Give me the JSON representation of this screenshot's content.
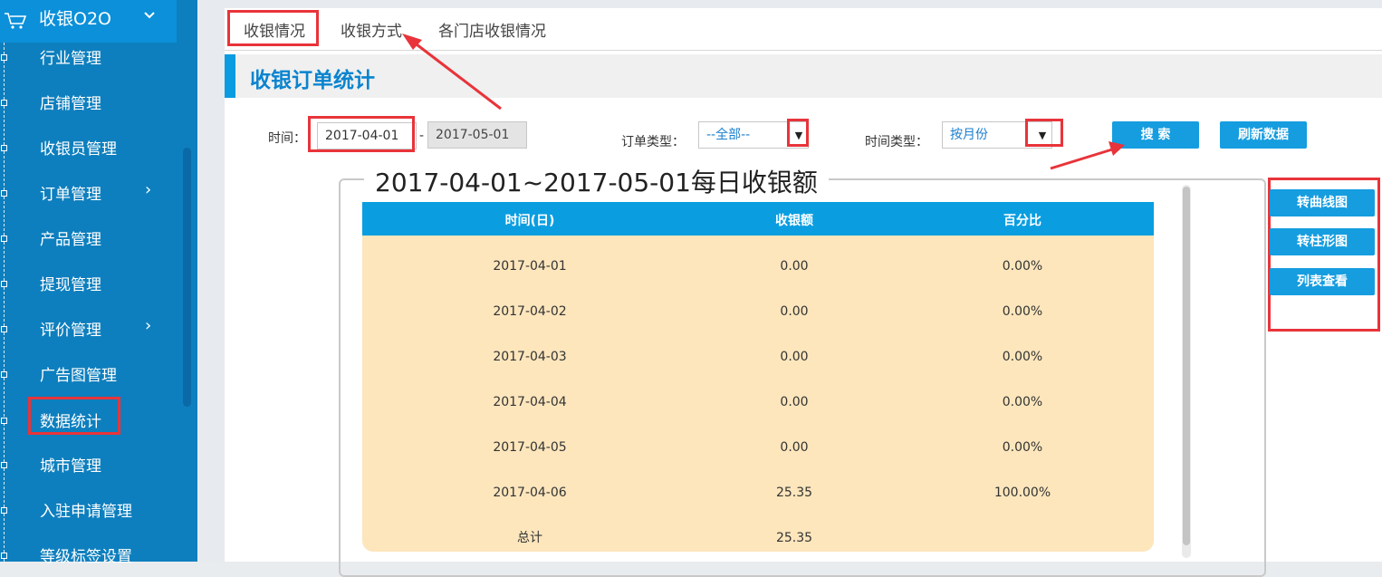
{
  "colors": {
    "sidebar": "#0e7fbe",
    "accent": "#0a9be0",
    "annotation_red": "#e8343a",
    "table_bg": "#fde6bc"
  },
  "sidebar": {
    "header": {
      "icon": "cart-icon",
      "title": "收银O2O",
      "toggle_icon": "chevron-down-icon"
    },
    "items": [
      {
        "label": "行业管理"
      },
      {
        "label": "店铺管理"
      },
      {
        "label": "收银员管理"
      },
      {
        "label": "订单管理",
        "arrow": "›"
      },
      {
        "label": "产品管理"
      },
      {
        "label": "提现管理"
      },
      {
        "label": "评价管理",
        "arrow": "›"
      },
      {
        "label": "广告图管理"
      },
      {
        "label": "数据统计",
        "active": true
      },
      {
        "label": "城市管理"
      },
      {
        "label": "入驻申请管理"
      },
      {
        "label": "等级标签设置"
      }
    ]
  },
  "tabs": [
    {
      "label": "收银情况",
      "active": true
    },
    {
      "label": "收银方式"
    },
    {
      "label": "各门店收银情况"
    }
  ],
  "section_title": "收银订单统计",
  "filters": {
    "time_label": "时间：",
    "start_date": "2017-04-01",
    "separator": "-",
    "end_date": "2017-05-01",
    "order_type_label": "订单类型：",
    "order_type_value": "--全部--",
    "time_type_label": "时间类型：",
    "time_type_value": "按月份",
    "caret": "▼",
    "search_button": "搜 索",
    "refresh_button": "刷新数据"
  },
  "report": {
    "title": "2017-04-01~2017-05-01每日收银额",
    "columns": [
      "时间(日)",
      "收银额",
      "百分比"
    ],
    "rows": [
      [
        "2017-04-01",
        "0.00",
        "0.00%"
      ],
      [
        "2017-04-02",
        "0.00",
        "0.00%"
      ],
      [
        "2017-04-03",
        "0.00",
        "0.00%"
      ],
      [
        "2017-04-04",
        "0.00",
        "0.00%"
      ],
      [
        "2017-04-05",
        "0.00",
        "0.00%"
      ],
      [
        "2017-04-06",
        "25.35",
        "100.00%"
      ],
      [
        "总计",
        "25.35",
        ""
      ]
    ]
  },
  "view_buttons": {
    "line_chart": "转曲线图",
    "bar_chart": "转柱形图",
    "list_view": "列表查看"
  }
}
